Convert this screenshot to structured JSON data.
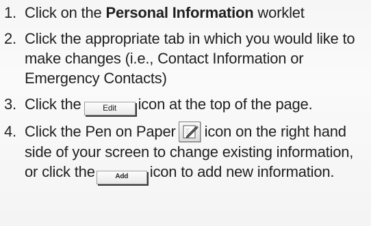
{
  "steps": [
    {
      "number": "1.",
      "pre": "Click on the ",
      "bold": "Personal Information",
      "post": " worklet"
    },
    {
      "number": "2.",
      "text": "Click the appropriate tab in which you would like to make changes (i.e., Contact Information or Emergency Contacts)"
    },
    {
      "number": "3.",
      "pre": "Click the",
      "button_label": "Edit",
      "post": "icon at the top of the page."
    },
    {
      "number": "4.",
      "pre": "Click the Pen on Paper",
      "icon": "pen-on-paper-icon",
      "mid": "icon on the right hand side of your screen to change existing information, or click the",
      "button_label": "Add",
      "post": "icon to add new information."
    }
  ]
}
